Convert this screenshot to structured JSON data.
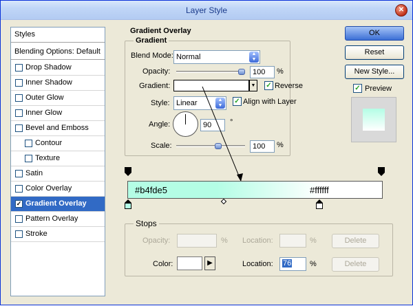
{
  "window": {
    "title": "Layer Style",
    "close_glyph": "✕"
  },
  "sidebar": {
    "header": "Styles",
    "blending": "Blending Options: Default",
    "items": [
      {
        "label": "Drop Shadow",
        "checked": false,
        "indent": false,
        "selected": false
      },
      {
        "label": "Inner Shadow",
        "checked": false,
        "indent": false,
        "selected": false
      },
      {
        "label": "Outer Glow",
        "checked": false,
        "indent": false,
        "selected": false
      },
      {
        "label": "Inner Glow",
        "checked": false,
        "indent": false,
        "selected": false
      },
      {
        "label": "Bevel and Emboss",
        "checked": false,
        "indent": false,
        "selected": false
      },
      {
        "label": "Contour",
        "checked": false,
        "indent": true,
        "selected": false
      },
      {
        "label": "Texture",
        "checked": false,
        "indent": true,
        "selected": false
      },
      {
        "label": "Satin",
        "checked": false,
        "indent": false,
        "selected": false
      },
      {
        "label": "Color Overlay",
        "checked": false,
        "indent": false,
        "selected": false
      },
      {
        "label": "Gradient Overlay",
        "checked": true,
        "indent": false,
        "selected": true
      },
      {
        "label": "Pattern Overlay",
        "checked": false,
        "indent": false,
        "selected": false
      },
      {
        "label": "Stroke",
        "checked": false,
        "indent": false,
        "selected": false
      }
    ]
  },
  "panel": {
    "title": "Gradient Overlay",
    "group_label": "Gradient",
    "blend_mode_label": "Blend Mode:",
    "blend_mode_value": "Normal",
    "opacity_label": "Opacity:",
    "opacity_value": "100",
    "percent": "%",
    "opacity_level": 1.0,
    "gradient_label": "Gradient:",
    "reverse_label": "Reverse",
    "reverse_checked": true,
    "style_label": "Style:",
    "style_value": "Linear",
    "align_label": "Align with Layer",
    "align_checked": true,
    "angle_label": "Angle:",
    "angle_value": "90",
    "degree": "°",
    "scale_label": "Scale:",
    "scale_value": "100",
    "scale_level": 0.62
  },
  "buttons": {
    "ok": "OK",
    "reset": "Reset",
    "new_style": "New Style...",
    "preview_label": "Preview",
    "preview_checked": true
  },
  "gradient_editor": {
    "left_color_label": "#b4fde5",
    "right_color_label": "#ffffff",
    "start_color": "#b4fde5",
    "end_color": "#ffffff",
    "stops_label": "Stops",
    "stop_opacity_label": "Opacity:",
    "stop_location_label": "Location:",
    "delete_label": "Delete",
    "color_label": "Color:",
    "color_location_label": "Location:",
    "color_location_value": "76",
    "percent": "%",
    "arrow_glyph": "▶"
  }
}
